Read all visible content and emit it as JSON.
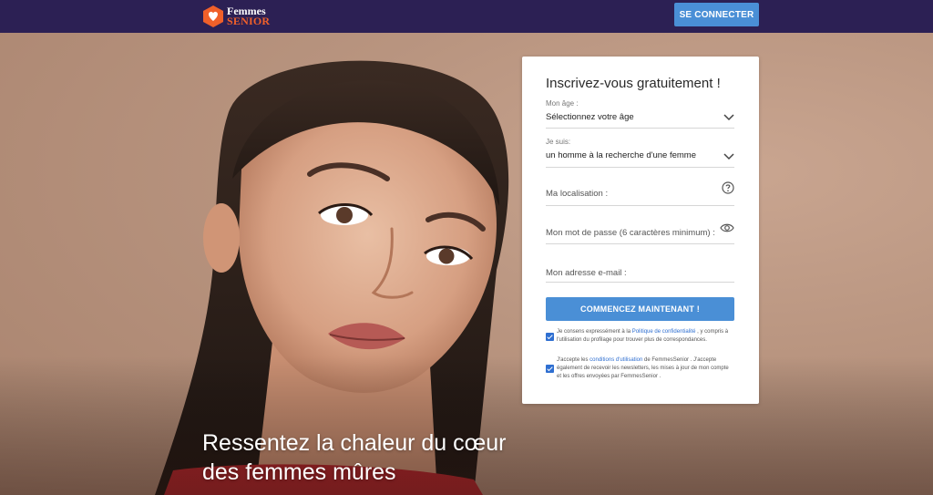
{
  "header": {
    "logo_line1": "Femmes",
    "logo_line2": "SENIOR",
    "connect_label": "SE CONNECTER"
  },
  "hero": {
    "headline_line1": "Ressentez la chaleur du cœur",
    "headline_line2": "des femmes mûres"
  },
  "signup": {
    "title": "Inscrivez-vous gratuitement !",
    "age_label": "Mon âge :",
    "age_value": "Sélectionnez votre âge",
    "gender_label": "Je suis:",
    "gender_value": "un homme à la recherche d'une femme",
    "location_placeholder": "Ma localisation :",
    "password_placeholder": "Mon mot de passe (6 caractères minimum) :",
    "email_placeholder": "Mon adresse e-mail :",
    "submit_label": "COMMENCEZ MAINTENANT !",
    "consent1_before": "Je consens expressément à la ",
    "consent1_link": "Politique de confidentialité",
    "consent1_after": " , y compris à l'utilisation du profilage pour trouver plus de correspondances.",
    "consent1_checked": true,
    "consent2_before": "J'accepte les ",
    "consent2_link": "conditions d'utilisation",
    "consent2_after": " de FemmesSenior . J'accepte également de recevoir les newsletters, les mises à jour de mon compte et les offres envoyées par FemmesSenior .",
    "consent2_checked": true
  },
  "colors": {
    "nav_bg": "#2c2054",
    "accent_blue": "#4a8fd6",
    "logo_orange": "#f0602a"
  },
  "icons": [
    "heart-logo-icon",
    "chevron-down-icon",
    "help-circle-icon",
    "eye-icon",
    "checkbox-checked-icon"
  ]
}
